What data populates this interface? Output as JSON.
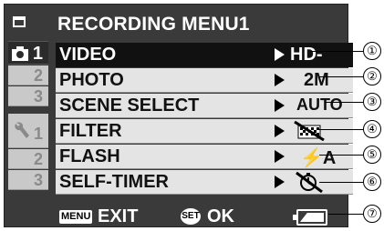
{
  "menu": {
    "title": "RECORDING MENU1",
    "rail": {
      "page1": "1",
      "page2": "2",
      "page3": "3",
      "setup1": "1",
      "setup2": "2",
      "setup3": "3"
    },
    "rows": [
      {
        "label": "VIDEO",
        "value": "HD-SHQ",
        "selected": true,
        "callout": "①"
      },
      {
        "label": "PHOTO",
        "value": "2M",
        "callout": "②"
      },
      {
        "label": "SCENE SELECT",
        "value": "AUTO",
        "callout": "③"
      },
      {
        "label": "FILTER",
        "value": "",
        "icon": "filter-icon",
        "callout": "④"
      },
      {
        "label": "FLASH",
        "value": "⚡A",
        "callout": "⑤"
      },
      {
        "label": "SELF-TIMER",
        "value": "",
        "icon": "self-timer-off-icon",
        "callout": "⑥"
      }
    ],
    "bottom": {
      "menu_key": "MENU",
      "exit": "EXIT",
      "set_key": "SET",
      "ok": "OK",
      "callout": "⑦",
      "battery_icon": "battery-icon"
    }
  }
}
